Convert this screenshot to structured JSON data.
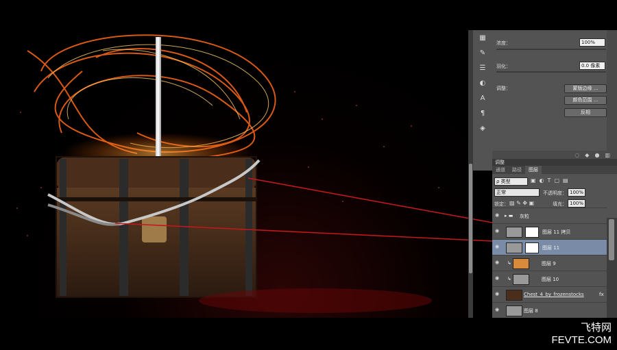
{
  "watermark": {
    "line1": "飞特网",
    "line2": "FEVTE.COM"
  },
  "toolstrip": {
    "icons": [
      "histogram-icon",
      "paint-icon",
      "sliders-icon",
      "adjust-icon",
      "type-icon",
      "paragraph-icon",
      "cube-icon"
    ]
  },
  "properties": {
    "density_label": "浓度：",
    "density_value": "100%",
    "feather_label": "羽化：",
    "feather_value": "0.0 像素",
    "refine_label": "调整：",
    "mask_edge_button": "蒙版边缘 ...",
    "color_range_button": "颜色范围 ...",
    "invert_button": "反相"
  },
  "panel_title": "调整",
  "tabs": [
    {
      "label": "通道",
      "active": false
    },
    {
      "label": "路径",
      "active": false
    },
    {
      "label": "图层",
      "active": true
    }
  ],
  "layers_panel": {
    "filter_kind": "ρ 类型",
    "blend_mode": "正常",
    "opacity_label": "不透明度：",
    "opacity_value": "100%",
    "lock_label": "锁定：",
    "fill_label": "填充：",
    "fill_value": "100%",
    "layers": [
      {
        "name": "灰粒",
        "type": "group",
        "selected": false
      },
      {
        "name": "图层 11 拷贝",
        "type": "masked",
        "selected": false
      },
      {
        "name": "图层 11",
        "type": "masked",
        "selected": true
      },
      {
        "name": "图层 9",
        "type": "clipped",
        "selected": false
      },
      {
        "name": "图层 10",
        "type": "clipped",
        "selected": false
      },
      {
        "name": "Chest_4_by_frozenstocks",
        "type": "smart",
        "selected": false
      },
      {
        "name": "图层 8",
        "type": "plain",
        "selected": false
      }
    ]
  },
  "colors": {
    "panel_bg": "#535353",
    "selected_row": "#7a8ba8",
    "arrow_red": "#c0191c"
  }
}
